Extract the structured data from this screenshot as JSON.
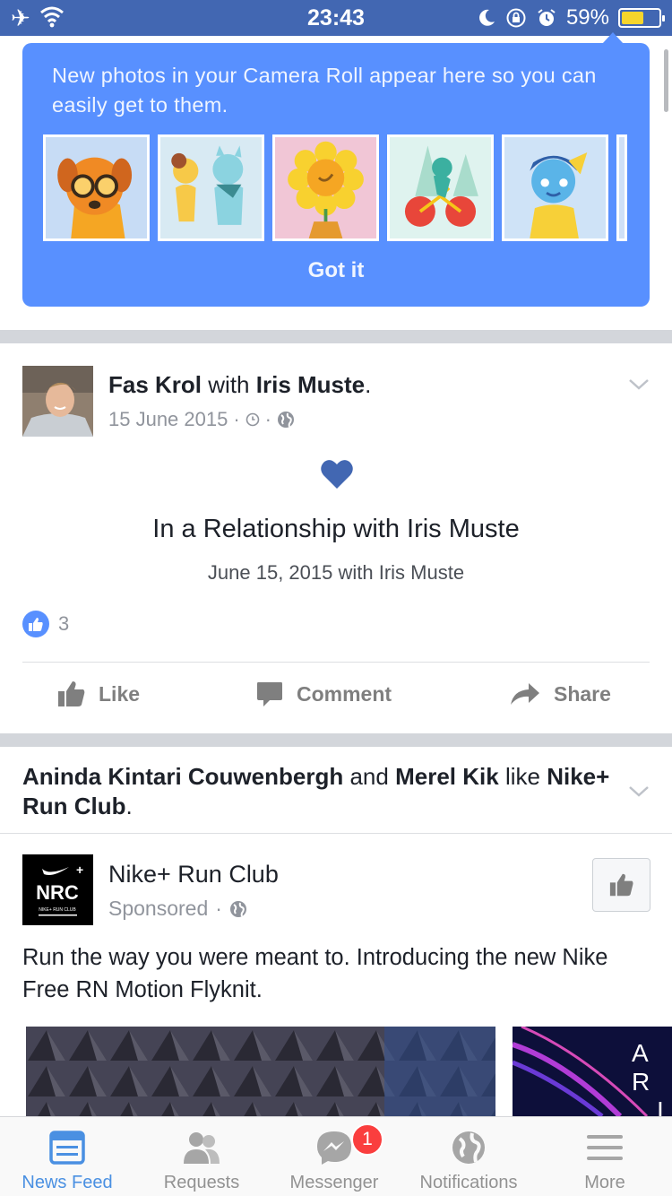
{
  "status_bar": {
    "time": "23:43",
    "battery_percent": "59%",
    "battery_level": 0.59
  },
  "camera_roll": {
    "message": "New photos in your Camera Roll appear here so you can easily get to them.",
    "got_it_label": "Got it"
  },
  "post_1": {
    "author": "Fas Krol",
    "with_word": "with",
    "tagged": "Iris Muste",
    "period": ".",
    "date": "15 June 2015",
    "separator": "·",
    "life_event_title": "In a Relationship with Iris Muste",
    "life_event_sub": "June 15, 2015 with Iris Muste",
    "like_count": "3",
    "actions": {
      "like": "Like",
      "comment": "Comment",
      "share": "Share"
    }
  },
  "story_2": {
    "friend_1": "Aninda Kintari Couwenbergh",
    "and_word": "and",
    "friend_2": "Merel Kik",
    "like_word": "like",
    "page": "Nike+ Run Club",
    "period": "."
  },
  "ad": {
    "page_name": "Nike+ Run Club",
    "sponsored": "Sponsored",
    "separator": "·",
    "logo_text": "NRC",
    "logo_small": "NIKE+ RUN CLUB",
    "text": "Run the way you were meant to. Introducing the new Nike Free RN Motion Flyknit.",
    "media_2_text_1": "A R",
    "media_2_text_2": "I"
  },
  "tab_bar": {
    "tabs": [
      {
        "label": "News Feed",
        "icon": "news-feed-icon",
        "active": true
      },
      {
        "label": "Requests",
        "icon": "friends-icon",
        "active": false
      },
      {
        "label": "Messenger",
        "icon": "messenger-icon",
        "active": false
      },
      {
        "label": "Notifications",
        "icon": "globe-icon",
        "active": false
      },
      {
        "label": "More",
        "icon": "menu-icon",
        "active": false
      }
    ],
    "messenger_badge": "1"
  },
  "colors": {
    "brand_blue": "#4267b2",
    "card_blue": "#5890ff",
    "active_tab": "#4a90e2",
    "badge_red": "#fa3e3e"
  }
}
